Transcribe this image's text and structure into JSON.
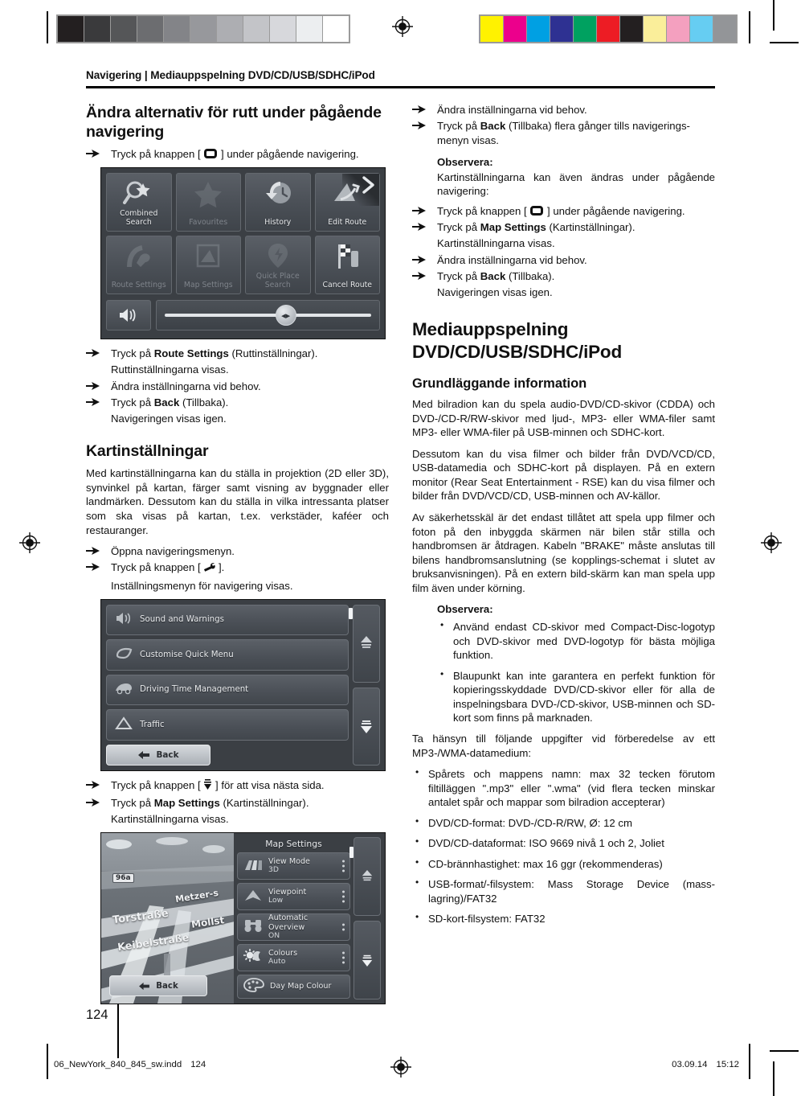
{
  "prepress": {
    "grey_steps": [
      "#231f20",
      "#3a3a3c",
      "#555658",
      "#6c6d70",
      "#838488",
      "#97989c",
      "#adaeb2",
      "#c3c4c8",
      "#d7d8dc",
      "#eceef0",
      "#ffffff"
    ],
    "color_patches": [
      "#fff200",
      "#ec008c",
      "#00a0e3",
      "#2e3192",
      "#00a160",
      "#ed1c24",
      "#231f20",
      "#faee9a",
      "#f4a0bf",
      "#66cdf2",
      "#939598"
    ],
    "registration_icon": "registration-target-icon"
  },
  "running_head": "Navigering | Mediauppspelning DVD/CD/USB/SDHC/iPod",
  "left_column": {
    "heading_route_options": "Ändra alternativ för rutt under pågående navigering",
    "steps_top": [
      {
        "pre": "Tryck på knappen [ ",
        "glyph": "map-button-icon",
        "post": " ] under pågående navigering."
      }
    ],
    "nav_screenshot": {
      "name": "navigation-menu-screenshot",
      "tiles": [
        {
          "label": "Combined Search",
          "icon": "magnifier-star-icon",
          "dim": false
        },
        {
          "label": "Favourites",
          "icon": "star-icon",
          "dim": true
        },
        {
          "label": "History",
          "icon": "clock-arrow-icon",
          "dim": false
        },
        {
          "label": "Edit Route",
          "icon": "route-edit-icon",
          "dim": false
        },
        {
          "label": "Route Settings",
          "icon": "road-wrench-icon",
          "dim": true
        },
        {
          "label": "Map Settings",
          "icon": "map-frame-icon",
          "dim": true
        },
        {
          "label": "Quick Place Search",
          "icon": "pin-lightning-icon",
          "dim": true
        },
        {
          "label": "Cancel Route",
          "icon": "checkered-flag-icon",
          "dim": false
        }
      ],
      "volume_icon": "speaker-icon",
      "slider_knob_icon": "slider-knob-icon"
    },
    "steps_route": [
      {
        "pre": "Tryck på ",
        "bold": "Route Settings",
        "post": " (Ruttinställningar)."
      },
      {
        "cont": "Ruttinställningarna visas."
      },
      {
        "pre": "Ändra inställningarna vid behov."
      },
      {
        "pre": "Tryck på ",
        "bold": "Back",
        "post": " (Tillbaka)."
      },
      {
        "cont": "Navigeringen visas igen."
      }
    ],
    "heading_map_settings": "Kartinställningar",
    "paragraph_map_settings": "Med kartinställningarna kan du ställa in projektion (2D eller 3D), synvinkel på kartan, färger samt visning av byggnader eller landmärken. Dessutom kan du ställa in vilka intressanta platser som ska visas på kartan, t.ex. verkstäder, kaféer och restauranger.",
    "steps_open_menu": [
      {
        "pre": "Öppna navigeringsmenyn."
      },
      {
        "pre": "Tryck på knappen [ ",
        "glyph": "wrench-icon",
        "post": " ]."
      },
      {
        "cont": "Inställningsmenyn för navigering visas."
      }
    ],
    "settings_screenshot": {
      "name": "navigation-settings-screenshot",
      "rows": [
        {
          "label": "Sound and Warnings",
          "icon": "speaker-icon"
        },
        {
          "label": "Customise Quick Menu",
          "icon": "leaf-icon"
        },
        {
          "label": "Driving Time Management",
          "icon": "wheel-icon"
        },
        {
          "label": "Traffic",
          "icon": "triangle-warning-icon"
        }
      ],
      "back_label": "Back",
      "scroll_up_icon": "scroll-up-icon",
      "scroll_down_icon": "scroll-down-icon"
    },
    "steps_next_page": [
      {
        "pre": "Tryck på knappen [ ",
        "glyph": "page-down-icon",
        "post": " ] för att visa nästa sida."
      },
      {
        "pre": "Tryck på ",
        "bold": "Map Settings",
        "post": " (Kartinställningar)."
      },
      {
        "cont": "Kartinställningarna visas."
      }
    ],
    "map_screenshot": {
      "name": "map-settings-screenshot",
      "title": "Map Settings",
      "back_label": "Back",
      "map_labels": [
        "Metzer-s",
        "Torstraße",
        "Mollst",
        "Keibelstraße"
      ],
      "map_shield": "96a",
      "rows": [
        {
          "label": "View Mode",
          "value": "3D",
          "icon": "road-3d-icon"
        },
        {
          "label": "Viewpoint",
          "value": "Low",
          "icon": "arrow-up-icon"
        },
        {
          "label": "Automatic Overview",
          "value": "ON",
          "icon": "binoculars-icon"
        },
        {
          "label": "Colours",
          "value": "Auto",
          "icon": "sun-moon-icon"
        },
        {
          "label": "Day Map Colour",
          "value": "",
          "icon": "palette-icon"
        }
      ]
    }
  },
  "right_column": {
    "steps_top": [
      {
        "pre": "Ändra inställningarna vid behov."
      },
      {
        "pre": "Tryck på ",
        "bold": "Back",
        "post": " (Tillbaka) flera gånger tills navigerings-menyn visas."
      }
    ],
    "note_1": {
      "title": "Observera:",
      "text": "Kartinställningarna kan även ändras under pågående navigering:"
    },
    "steps_note": [
      {
        "pre": "Tryck på knappen [ ",
        "glyph": "map-button-icon",
        "post": " ] under pågående navigering."
      },
      {
        "pre": "Tryck på ",
        "bold": "Map Settings",
        "post": " (Kartinställningar)."
      },
      {
        "cont": "Kartinställningarna visas."
      },
      {
        "pre": "Ändra inställningarna vid behov."
      },
      {
        "pre": "Tryck på ",
        "bold": "Back",
        "post": " (Tillbaka)."
      },
      {
        "cont": "Navigeringen visas igen."
      }
    ],
    "heading_media": "Mediauppspelning DVD/CD/USB/SDHC/iPod",
    "heading_basic": "Grundläggande information",
    "para_1": "Med bilradion kan du spela audio-DVD/CD-skivor (CDDA) och DVD-/CD-R/RW-skivor med ljud-, MP3- eller WMA-filer samt MP3- eller WMA-filer på USB-minnen och SDHC-kort.",
    "para_2": "Dessutom kan du visa filmer och bilder från DVD/VCD/CD, USB-datamedia och SDHC-kort på displayen. På en extern monitor (Rear Seat Entertainment - RSE) kan du visa filmer och bilder från DVD/VCD/CD, USB-minnen och AV-källor.",
    "para_3": "Av säkerhetsskäl är det endast tillåtet att spela upp filmer och foton på den inbyggda skärmen när bilen står stilla och handbromsen är åtdragen. Kabeln \"BRAKE\" måste anslutas till bilens handbromsanslutning (se kopplings-schemat i slutet av bruksanvisningen). På en extern bild-skärm kan man spela upp film även under körning.",
    "note_2": {
      "title": "Observera:",
      "bullets": [
        "Använd endast CD-skivor med Compact-Disc-logotyp och DVD-skivor med DVD-logotyp för bästa möjliga funktion.",
        "Blaupunkt kan inte garantera en perfekt funktion för kopieringsskyddade DVD/CD-skivor eller för alla de inspelningsbara DVD-/CD-skivor, USB-minnen och SD-kort som finns på marknaden."
      ]
    },
    "para_4": "Ta hänsyn till följande uppgifter vid förberedelse av ett MP3-/WMA-datamedium:",
    "spec_bullets": [
      "Spårets och mappens namn: max 32 tecken förutom filtilläggen \".mp3\" eller \".wma\" (vid flera tecken minskar antalet spår och mappar som bilradion accepterar)",
      "DVD/CD-format: DVD-/CD-R/RW, Ø: 12 cm",
      "DVD/CD-dataformat: ISO 9669 nivå 1 och 2, Joliet",
      "CD-brännhastighet: max 16 ggr (rekommenderas)",
      "USB-format/-filsystem: Mass Storage Device (mass-lagring)/FAT32",
      "SD-kort-filsystem: FAT32"
    ]
  },
  "folio": "124",
  "footer": {
    "file": "06_NewYork_840_845_sw.indd",
    "page": "124",
    "date": "03.09.14",
    "time": "15:12"
  }
}
